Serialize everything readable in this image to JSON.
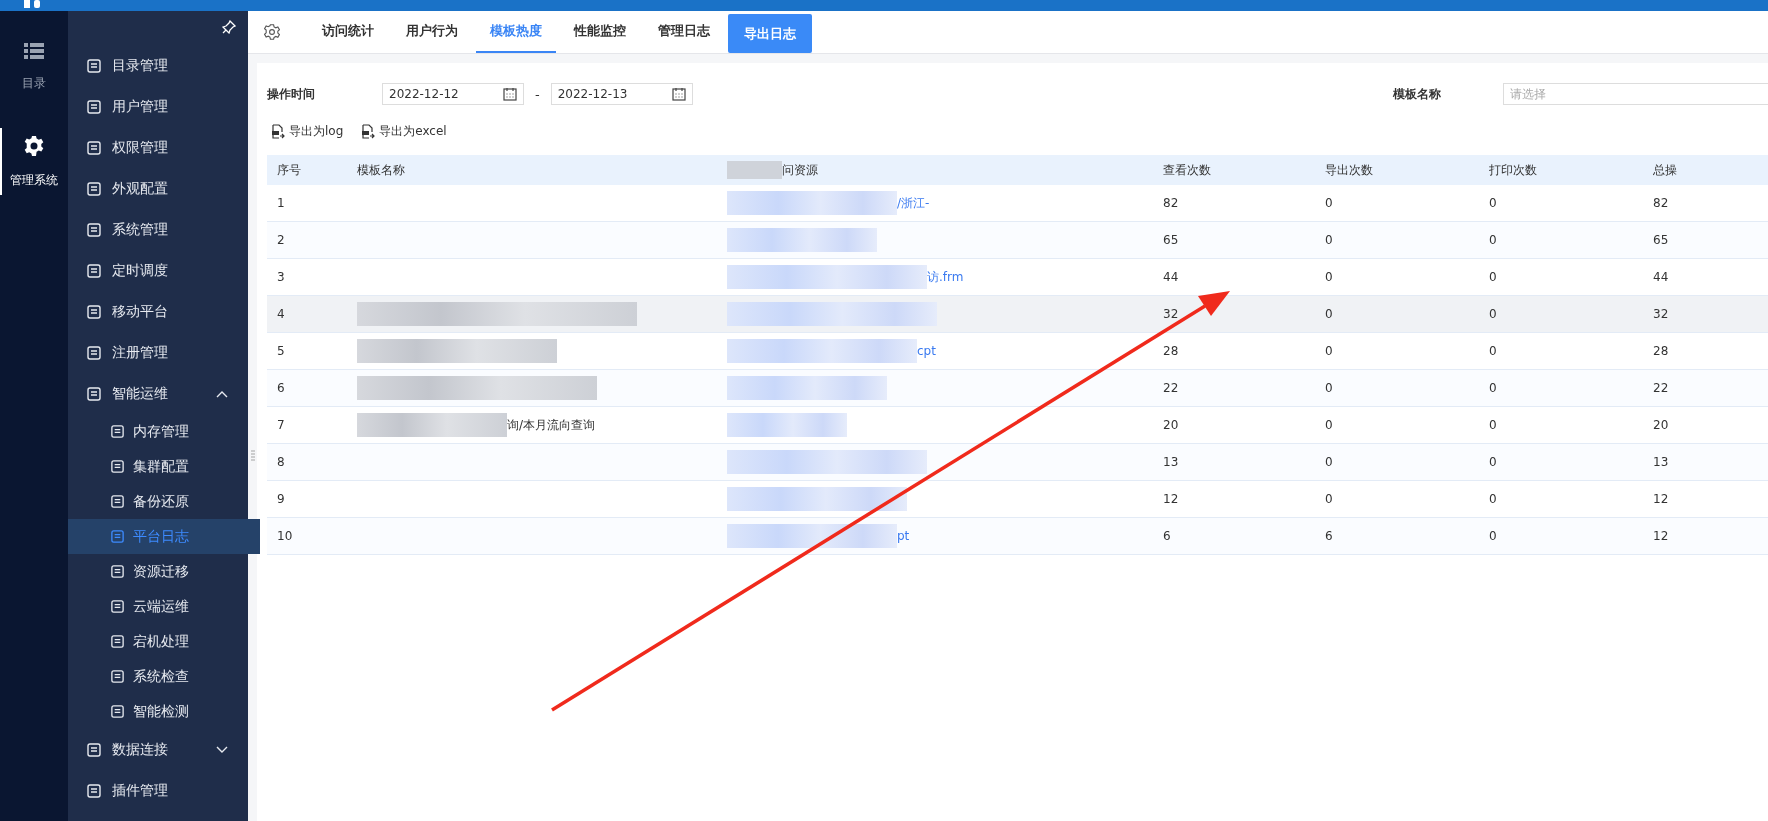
{
  "rail": [
    {
      "label": "目录",
      "selected": false
    },
    {
      "label": "管理系统",
      "selected": true
    }
  ],
  "menu": [
    {
      "label": "目录管理",
      "selected": false
    },
    {
      "label": "用户管理",
      "selected": false
    },
    {
      "label": "权限管理",
      "selected": false
    },
    {
      "label": "外观配置",
      "selected": false
    },
    {
      "label": "系统管理",
      "selected": false
    },
    {
      "label": "定时调度",
      "selected": false
    },
    {
      "label": "移动平台",
      "selected": false
    },
    {
      "label": "注册管理",
      "selected": false
    },
    {
      "label": "智能运维",
      "selected": false,
      "expanded": true,
      "children": [
        {
          "label": "内存管理",
          "selected": false
        },
        {
          "label": "集群配置",
          "selected": false
        },
        {
          "label": "备份还原",
          "selected": false
        },
        {
          "label": "平台日志",
          "selected": true
        },
        {
          "label": "资源迁移",
          "selected": false
        },
        {
          "label": "云端运维",
          "selected": false
        },
        {
          "label": "宕机处理",
          "selected": false
        },
        {
          "label": "系统检查",
          "selected": false
        },
        {
          "label": "智能检测",
          "selected": false
        }
      ]
    },
    {
      "label": "数据连接",
      "selected": false,
      "expanded": false
    },
    {
      "label": "插件管理",
      "selected": false
    }
  ],
  "tabs": [
    {
      "label": "访问统计",
      "kind": "tab",
      "selected": false
    },
    {
      "label": "用户行为",
      "kind": "tab",
      "selected": false
    },
    {
      "label": "模板热度",
      "kind": "tab",
      "selected": true
    },
    {
      "label": "性能监控",
      "kind": "tab",
      "selected": false
    },
    {
      "label": "管理日志",
      "kind": "tab",
      "selected": false
    },
    {
      "label": "导出日志",
      "kind": "button",
      "selected": false
    }
  ],
  "filters": {
    "time_label": "操作时间",
    "start_date": "2022-12-12",
    "separator": "-",
    "end_date": "2022-12-13",
    "template_label": "模板名称",
    "template_placeholder": "请选择"
  },
  "actions": [
    "导出为log",
    "导出为excel"
  ],
  "table": {
    "columns": [
      {
        "label": "序号",
        "blurred": false
      },
      {
        "label": "模板名称",
        "blurred": false
      },
      {
        "label": "问资源",
        "blurred": true
      },
      {
        "label": "查看次数",
        "blurred": false
      },
      {
        "label": "导出次数",
        "blurred": false
      },
      {
        "label": "打印次数",
        "blurred": false
      },
      {
        "label": "总操",
        "blurred": false
      }
    ],
    "rows": [
      {
        "index": "1",
        "resource": "/浙江-",
        "resource_blurred": true,
        "views": "82",
        "exports": "0",
        "prints": "0",
        "total": "82",
        "hovered": false
      },
      {
        "index": "2",
        "resource_blurred": true,
        "views": "65",
        "exports": "0",
        "prints": "0",
        "total": "65",
        "hovered": false
      },
      {
        "index": "3",
        "resource": "访.frm",
        "resource_blurred": true,
        "views": "44",
        "exports": "0",
        "prints": "0",
        "total": "44",
        "hovered": false
      },
      {
        "index": "4",
        "name_blurred": true,
        "resource_blurred": true,
        "views": "32",
        "exports": "0",
        "prints": "0",
        "total": "32",
        "hovered": true
      },
      {
        "index": "5",
        "name_blurred": true,
        "resource": "cpt",
        "resource_blurred": true,
        "views": "28",
        "exports": "0",
        "prints": "0",
        "total": "28",
        "hovered": false
      },
      {
        "index": "6",
        "name_blurred": true,
        "resource_blurred": true,
        "views": "22",
        "exports": "0",
        "prints": "0",
        "total": "22",
        "hovered": false
      },
      {
        "index": "7",
        "name": "询/本月流向查询",
        "name_blurred": true,
        "resource_blurred": true,
        "views": "20",
        "exports": "0",
        "prints": "0",
        "total": "20",
        "hovered": false
      },
      {
        "index": "8",
        "resource_blurred": true,
        "views": "13",
        "exports": "0",
        "prints": "0",
        "total": "13",
        "hovered": false
      },
      {
        "index": "9",
        "resource_blurred": true,
        "views": "12",
        "exports": "0",
        "prints": "0",
        "total": "12",
        "hovered": false
      },
      {
        "index": "10",
        "resource": "pt",
        "resource_blurred": true,
        "views": "6",
        "exports": "6",
        "prints": "0",
        "total": "12",
        "hovered": false
      }
    ]
  }
}
